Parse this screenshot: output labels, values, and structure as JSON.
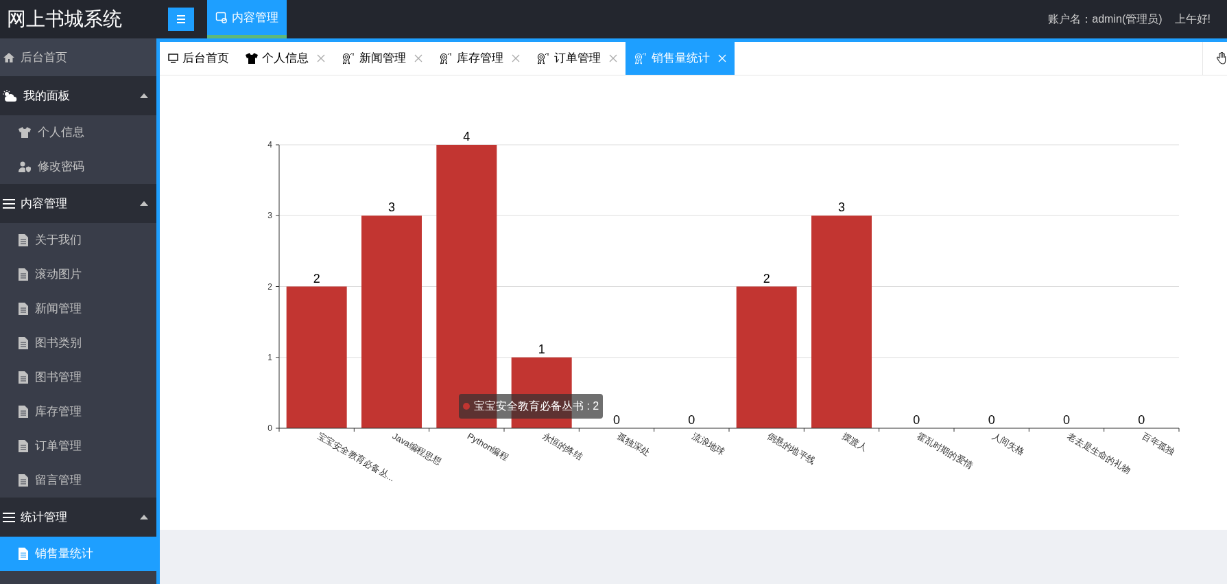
{
  "header": {
    "title": "网上书城系统",
    "nav": [
      {
        "label": "内容管理",
        "selected": true
      }
    ],
    "account": "账户名：admin(管理员)",
    "greeting": "上午好!"
  },
  "sidebar": {
    "items": [
      {
        "kind": "link",
        "label": "后台首页",
        "selected": false
      },
      {
        "kind": "group",
        "label": "我的面板",
        "expanded": true,
        "children": [
          {
            "label": "个人信息",
            "selected": false
          },
          {
            "label": "修改密码",
            "selected": false
          }
        ]
      },
      {
        "kind": "group",
        "label": "内容管理",
        "expanded": true,
        "children": [
          {
            "label": "关于我们",
            "selected": false
          },
          {
            "label": "滚动图片",
            "selected": false
          },
          {
            "label": "新闻管理",
            "selected": false
          },
          {
            "label": "图书类别",
            "selected": false
          },
          {
            "label": "图书管理",
            "selected": false
          },
          {
            "label": "库存管理",
            "selected": false
          },
          {
            "label": "订单管理",
            "selected": false
          },
          {
            "label": "留言管理",
            "selected": false
          }
        ]
      },
      {
        "kind": "group",
        "label": "统计管理",
        "expanded": true,
        "children": [
          {
            "label": "销售量统计",
            "selected": true
          }
        ]
      }
    ]
  },
  "tabs": [
    {
      "label": "后台首页",
      "closable": false,
      "selected": false
    },
    {
      "label": "个人信息",
      "closable": true,
      "selected": false
    },
    {
      "label": "新闻管理",
      "closable": true,
      "selected": false
    },
    {
      "label": "库存管理",
      "closable": true,
      "selected": false
    },
    {
      "label": "订单管理",
      "closable": true,
      "selected": false
    },
    {
      "label": "销售量统计",
      "closable": true,
      "selected": true
    }
  ],
  "chart_data": {
    "type": "bar",
    "categories": [
      "宝宝安全教育必备丛...",
      "Java编程思想",
      "Python编程",
      "永恒的终结",
      "孤独深处",
      "流浪地球",
      "倒悬的地平线",
      "摆渡人",
      "霍乱时期的爱情",
      "人间失格",
      "老去是生命的礼物",
      "百年孤独"
    ],
    "series": [
      {
        "color": "#c23531",
        "values": [
          2,
          3,
          4,
          1,
          0,
          0,
          2,
          3,
          0,
          0,
          0,
          0
        ]
      }
    ],
    "grid": true,
    "ylim": [
      0,
      4
    ],
    "yticks": [
      0,
      1,
      2,
      3,
      4
    ],
    "data_labels": true
  },
  "tooltip": {
    "text": "宝宝安全教育必备丛书 : 2",
    "color": "#c23531"
  }
}
